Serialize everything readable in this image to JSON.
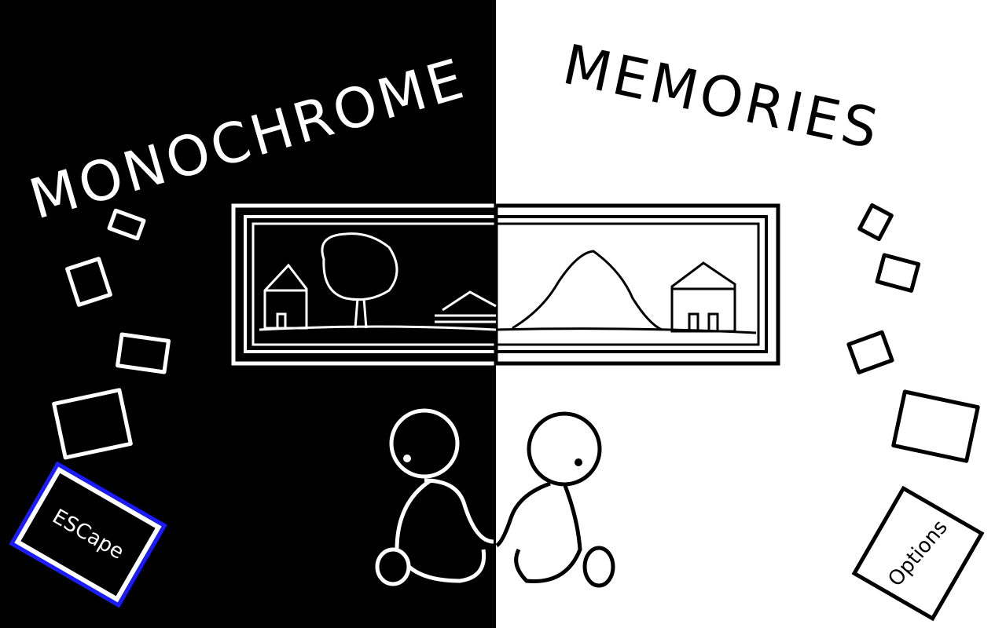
{
  "title": {
    "left_word": "MONOCHROME",
    "right_word": "MEMORIES"
  },
  "menu": {
    "escape_label": "ESCape",
    "options_label": "Options"
  },
  "colors": {
    "left_bg": "#000000",
    "right_bg": "#ffffff",
    "escape_outline": "#1b1bff"
  },
  "icons": {
    "painting": "framed-landscape-painting",
    "characters": "two-sitting-figures-holding-hands",
    "cards": "floating-memory-cards"
  }
}
